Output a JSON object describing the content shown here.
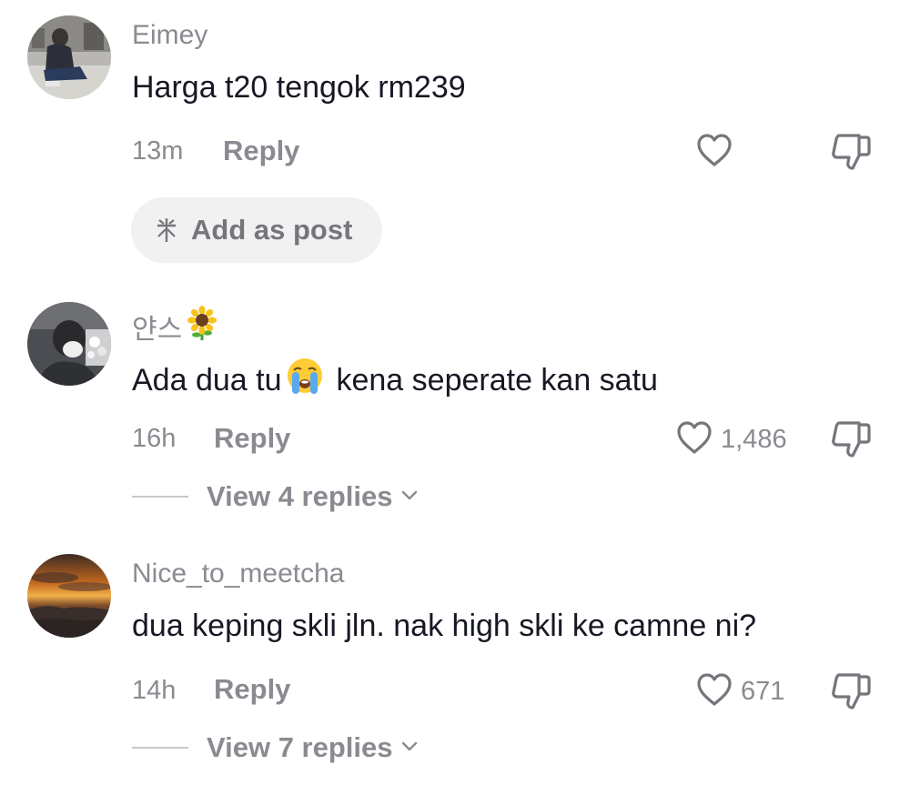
{
  "comments": [
    {
      "username": "Eimey",
      "text": "Harga t20 tengok rm239",
      "time": "13m",
      "reply_label": "Reply",
      "like_count": "",
      "add_post_label": "Add as post"
    },
    {
      "username": "얀스",
      "username_emoji": "sunflower",
      "text_before": "Ada dua tu",
      "text_emoji": "loudly-crying-face",
      "text_after": "kena seperate kan satu",
      "time": "16h",
      "reply_label": "Reply",
      "like_count": "1,486",
      "view_replies": "View 4 replies"
    },
    {
      "username": "Nice_to_meetcha",
      "text": "dua keping skli jln. nak high skli ke camne ni?",
      "time": "14h",
      "reply_label": "Reply",
      "like_count": "671",
      "view_replies": "View 7 replies"
    }
  ],
  "icons": {
    "like": "heart-outline-icon",
    "dislike": "thumbs-down-outline-icon",
    "add_post": "sparkle-icon",
    "expand": "chevron-down-icon"
  },
  "colors": {
    "text_primary": "#161823",
    "text_secondary": "#8a8b91",
    "pill_background": "#f1f1f2"
  }
}
